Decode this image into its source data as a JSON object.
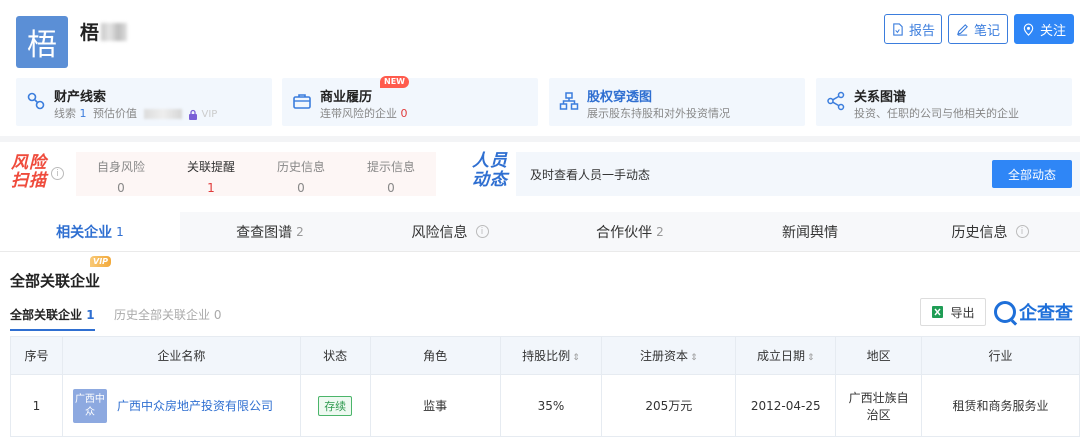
{
  "header": {
    "avatar_char": "梧",
    "name": "梧",
    "buttons": {
      "report": "报告",
      "notes": "笔记",
      "follow": "关注"
    }
  },
  "cards": [
    {
      "title": "财产线索",
      "sub_prefix": "线索",
      "sub_count": "1",
      "sub_middle": "预估价值",
      "sub_suffix": "VIP",
      "icon": "property-clue-icon"
    },
    {
      "title": "商业履历",
      "badge": "NEW",
      "sub_prefix": "连带风险的企业",
      "sub_count": "0",
      "icon": "briefcase-icon"
    },
    {
      "title": "股权穿透图",
      "sub_prefix": "展示股东持股和对外投资情况",
      "icon": "org-chart-icon"
    },
    {
      "title": "关系图谱",
      "sub_prefix": "投资、任职的公司与他相关的企业",
      "icon": "share-graph-icon"
    }
  ],
  "risk": {
    "logo_line1": "风险",
    "logo_line2": "扫描",
    "items": [
      {
        "label": "自身风险",
        "value": "0"
      },
      {
        "label": "关联提醒",
        "value": "1"
      },
      {
        "label": "历史信息",
        "value": "0"
      },
      {
        "label": "提示信息",
        "value": "0"
      }
    ]
  },
  "people": {
    "logo_line1": "人员",
    "logo_line2": "动态",
    "text": "及时查看人员一手动态",
    "button": "全部动态"
  },
  "tabs": [
    {
      "label": "相关企业",
      "count": "1"
    },
    {
      "label": "查查图谱",
      "count": "2"
    },
    {
      "label": "风险信息",
      "count": ""
    },
    {
      "label": "合作伙伴",
      "count": "2"
    },
    {
      "label": "新闻舆情",
      "count": ""
    },
    {
      "label": "历史信息",
      "count": ""
    }
  ],
  "section": {
    "title": "全部关联企业",
    "vip": "VIP",
    "subtab_active": "全部关联企业",
    "subtab_active_count": "1",
    "subtab_inactive": "历史全部关联企业",
    "subtab_inactive_count": "0",
    "export": "导出",
    "brand": "企查查"
  },
  "table": {
    "headers": [
      "序号",
      "企业名称",
      "状态",
      "角色",
      "持股比例",
      "注册资本",
      "成立日期",
      "地区",
      "行业"
    ],
    "rows": [
      {
        "index": "1",
        "logo_text": "广西中众",
        "company": "广西中众房地产投资有限公司",
        "status": "存续",
        "role": "监事",
        "share": "35%",
        "capital": "205万元",
        "date": "2012-04-25",
        "region": "广西壮族自治区",
        "industry": "租赁和商务服务业"
      }
    ]
  },
  "colors": {
    "accent": "#2f86f6",
    "risk_red": "#ef4b3c",
    "status_green": "#2f9a4f"
  }
}
